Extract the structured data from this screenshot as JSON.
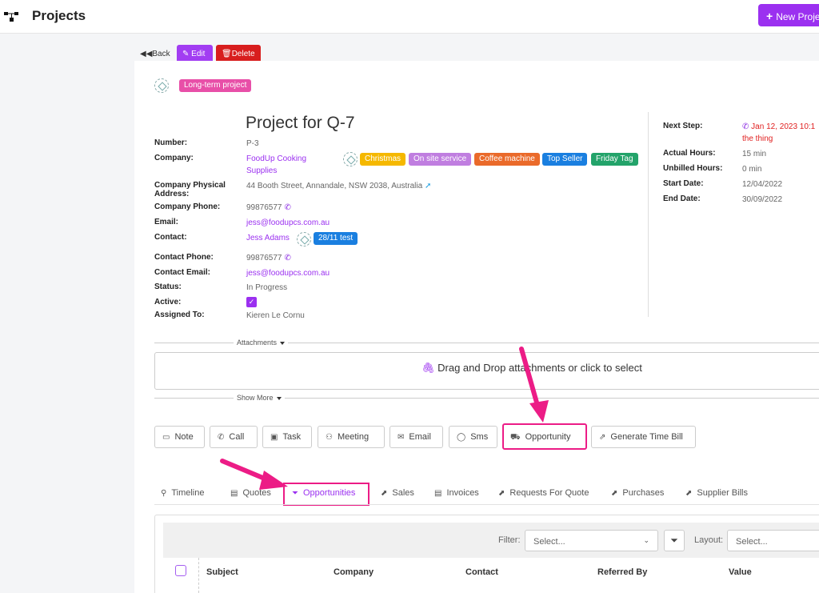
{
  "header": {
    "title": "Projects",
    "new_button": "New Project"
  },
  "actions": {
    "back": "Back",
    "edit": "Edit",
    "delete": "Delete"
  },
  "project_tag": "Long-term project",
  "project": {
    "title": "Project for Q-7",
    "fields": {
      "number_label": "Number:",
      "number": "P-3",
      "company_label": "Company:",
      "company_line1": "FoodUp Cooking",
      "company_line2": "Supplies",
      "address_label_1": "Company Physical",
      "address_label_2": "Address:",
      "address": "44 Booth Street, Annandale, NSW 2038, Australia",
      "company_phone_label": "Company Phone:",
      "company_phone": "99876577",
      "email_label": "Email:",
      "email": "jess@foodupcs.com.au",
      "contact_label": "Contact:",
      "contact": "Jess Adams",
      "contact_phone_label": "Contact Phone:",
      "contact_phone": "99876577",
      "contact_email_label": "Contact Email:",
      "contact_email": "jess@foodupcs.com.au",
      "status_label": "Status:",
      "status": "In Progress",
      "active_label": "Active:",
      "assigned_label": "Assigned To:",
      "assigned": "Kieren Le Cornu"
    },
    "company_tags": [
      {
        "label": "Christmas",
        "color": "#f5b800"
      },
      {
        "label": "On site service",
        "color": "#c07ee0"
      },
      {
        "label": "Coffee machine",
        "color": "#ea6a2a"
      },
      {
        "label": "Top Seller",
        "color": "#1a7fe0"
      },
      {
        "label": "Friday Tag",
        "color": "#23a36a"
      }
    ],
    "contact_tag": {
      "label": "28/11 test",
      "color": "#1a7fe0"
    },
    "right": {
      "next_step_label": "Next Step:",
      "next_step": "Jan 12, 2023 10:1",
      "next_step_2": "the thing",
      "actual_hours_label": "Actual Hours:",
      "actual_hours": "15 min",
      "unbilled_label": "Unbilled Hours:",
      "unbilled": "0 min",
      "start_label": "Start Date:",
      "start": "12/04/2022",
      "end_label": "End Date:",
      "end": "30/09/2022"
    }
  },
  "attachments": {
    "label": "Attachments",
    "drop_text": "Drag and Drop attachments or click to select"
  },
  "show_more": "Show More",
  "activity_buttons": [
    "Note",
    "Call",
    "Task",
    "Meeting",
    "Email",
    "Sms",
    "Opportunity",
    "Generate Time Bill"
  ],
  "tabs": [
    "Timeline",
    "Quotes",
    "Opportunities",
    "Sales",
    "Invoices",
    "Requests For Quote",
    "Purchases",
    "Supplier Bills"
  ],
  "grid": {
    "filter_label": "Filter:",
    "filter_placeholder": "Select...",
    "layout_label": "Layout:",
    "layout_placeholder": "Select...",
    "columns": [
      "Subject",
      "Company",
      "Contact",
      "Referred By",
      "Value"
    ]
  },
  "colors": {
    "accent": "#9b30f0",
    "delete": "#d81e1e",
    "annotation": "#ec1c86",
    "project_tag": "#e84fa8"
  }
}
